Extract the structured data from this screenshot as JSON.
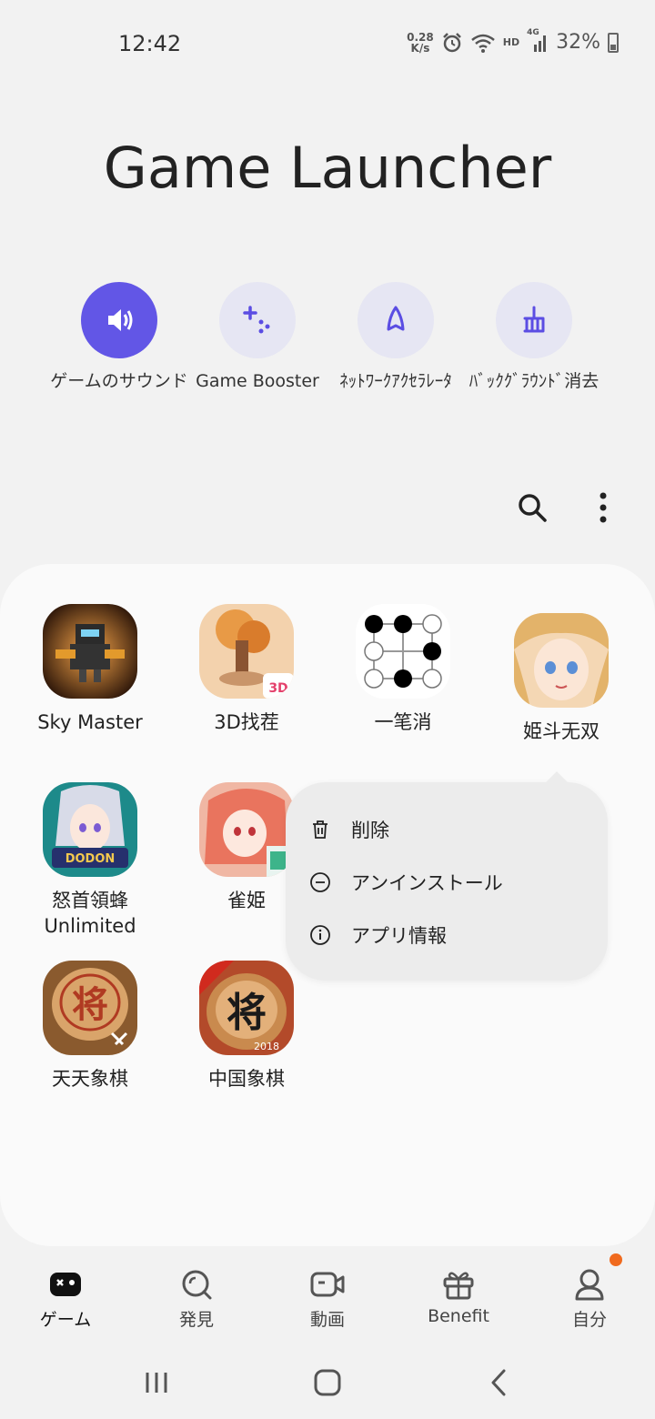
{
  "status": {
    "time": "12:42",
    "net_speed_value": "0.28",
    "net_speed_unit": "K/s",
    "hd": "HD",
    "network": "4G",
    "battery": "32%",
    "icons": [
      "alarm-icon",
      "wifi-icon",
      "signal-icon",
      "battery-icon"
    ]
  },
  "title": "Game Launcher",
  "quick_actions": [
    {
      "label": "ゲームのサウンド",
      "icon": "speaker-icon",
      "active": true
    },
    {
      "label": "Game Booster",
      "icon": "sparkle-icon",
      "active": false
    },
    {
      "label": "ﾈｯﾄﾜｰｸｱｸｾﾗﾚｰﾀ",
      "icon": "rocket-icon",
      "active": false
    },
    {
      "label": "ﾊﾞｯｸｸﾞﾗｳﾝﾄﾞ消去",
      "icon": "broom-icon",
      "active": false
    }
  ],
  "toolbar": {
    "search_icon": "search-icon",
    "more_icon": "more-icon"
  },
  "apps": [
    {
      "name": "Sky Master"
    },
    {
      "name": "3D找茬"
    },
    {
      "name": "一笔消"
    },
    {
      "name": "姫斗无双"
    },
    {
      "name": "怒首領蜂 Unlimited"
    },
    {
      "name": "雀姫"
    },
    {
      "name": "天天象棋"
    },
    {
      "name": "中国象棋"
    }
  ],
  "context_menu": {
    "items": [
      {
        "label": "削除",
        "icon": "trash-icon"
      },
      {
        "label": "アンインストール",
        "icon": "minus-circle-icon"
      },
      {
        "label": "アプリ情報",
        "icon": "info-icon"
      }
    ],
    "partial_text": "i"
  },
  "bottom_nav": [
    {
      "label": "ゲーム",
      "icon": "gamepad-icon",
      "active": true
    },
    {
      "label": "発見",
      "icon": "discover-icon",
      "active": false
    },
    {
      "label": "動画",
      "icon": "video-icon",
      "active": false
    },
    {
      "label": "Benefit",
      "icon": "gift-icon",
      "active": false
    },
    {
      "label": "自分",
      "icon": "profile-icon",
      "active": false,
      "badge": true
    }
  ],
  "colors": {
    "accent": "#6256e6",
    "badge": "#f06a1e"
  }
}
